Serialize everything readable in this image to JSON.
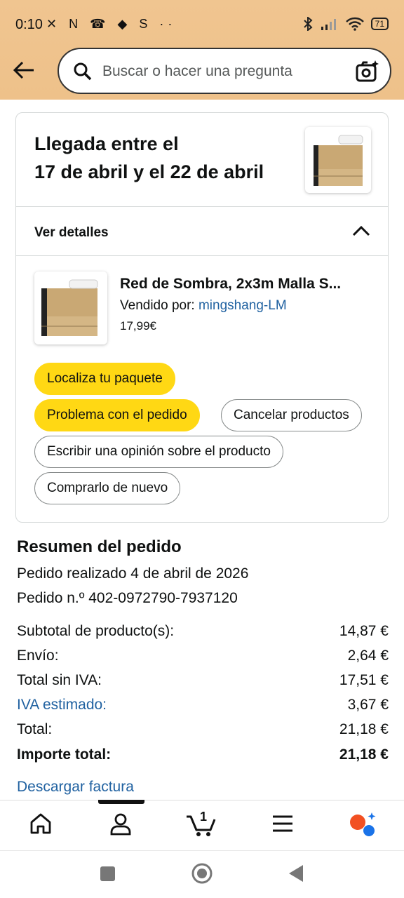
{
  "status_bar": {
    "time": "0:10",
    "icons": "✕ N ☎ ◆ S ··",
    "battery": "71"
  },
  "search": {
    "placeholder": "Buscar o hacer una pregunta"
  },
  "delivery": {
    "line1": "Llegada entre el",
    "line2": "17 de abril y el 22 de abril"
  },
  "details_toggle": "Ver detalles",
  "product": {
    "name": "Red de Sombra, 2x3m Malla S...",
    "seller_prefix": "Vendido por:",
    "seller": "mingshang-LM",
    "price": "17,99€"
  },
  "actions": {
    "track": "Localiza tu paquete",
    "problem": "Problema con el pedido",
    "cancel": "Cancelar productos",
    "review": "Escribir una opinión sobre el producto",
    "buy_again": "Comprarlo de nuevo"
  },
  "summary": {
    "title": "Resumen del pedido",
    "placed": "Pedido realizado 4 de abril de 2026",
    "order_number": "Pedido n.º 402-0972790-7937120",
    "rows": [
      {
        "label": "Subtotal de producto(s):",
        "value": "14,87 €"
      },
      {
        "label": "Envío:",
        "value": "2,64 €"
      },
      {
        "label": "Total sin IVA:",
        "value": "17,51 €"
      },
      {
        "label": "IVA estimado:",
        "value": "3,67 €"
      },
      {
        "label": "Total:",
        "value": "21,18 €"
      },
      {
        "label": "Importe total:",
        "value": "21,18 €"
      }
    ],
    "invoice_link": "Descargar factura"
  },
  "bottom_nav": {
    "cart_count": "1"
  },
  "colors": {
    "header": "#f0c590",
    "accent_yellow": "#ffd814",
    "link_blue": "#2162a1"
  }
}
